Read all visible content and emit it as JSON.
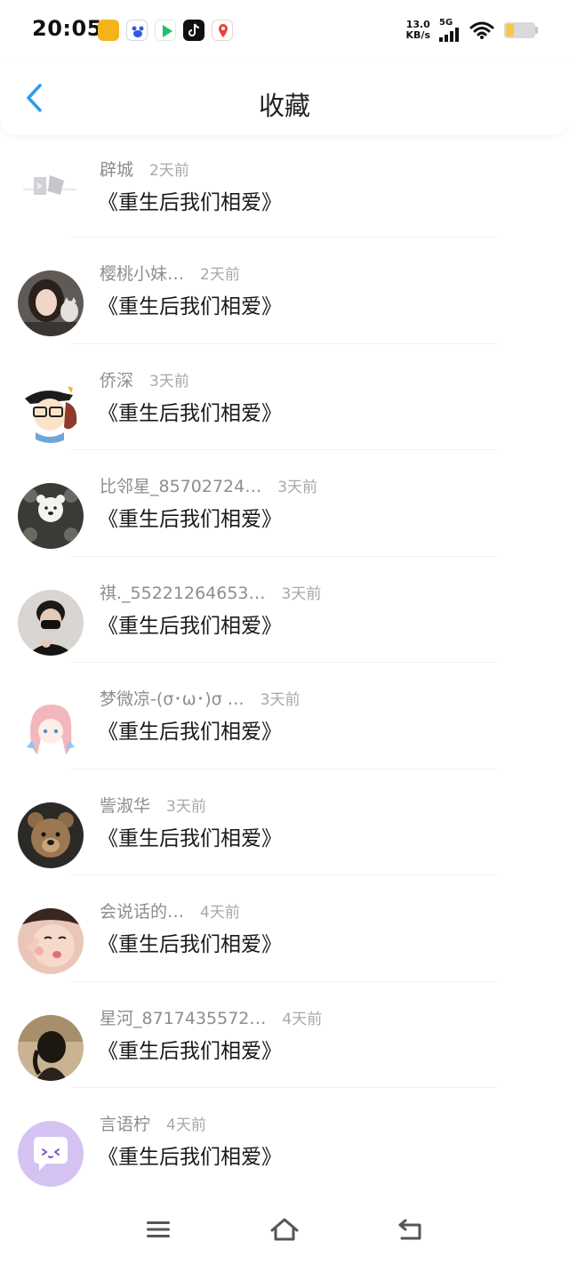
{
  "status_bar": {
    "time": "20:05",
    "net_speed_value": "13.0",
    "net_speed_unit": "KB/s",
    "network": "5G",
    "battery_color": "#f2c94c"
  },
  "header": {
    "title": "收藏",
    "back_icon": "chevron-left-icon",
    "accent_color": "#2f9bea"
  },
  "favorites": [
    {
      "user": "辟城",
      "time": "2天前",
      "title": "《重生后我们相爱》",
      "avatar": "placeholder-logo"
    },
    {
      "user": "樱桃小妹…",
      "time": "2天前",
      "title": "《重生后我们相爱》",
      "avatar": "girl-with-cat"
    },
    {
      "user": "侨深",
      "time": "3天前",
      "title": "《重生后我们相爱》",
      "avatar": "cartoon-boy"
    },
    {
      "user": "比邻星_85702724…",
      "time": "3天前",
      "title": "《重生后我们相爱》",
      "avatar": "bear-pattern"
    },
    {
      "user": "祺._55221264653…",
      "time": "3天前",
      "title": "《重生后我们相爱》",
      "avatar": "masked-boy"
    },
    {
      "user": "梦微凉-(σ･ω･)σ …",
      "time": "3天前",
      "title": "《重生后我们相爱》",
      "avatar": "anime-girl"
    },
    {
      "user": "訾淑华",
      "time": "3天前",
      "title": "《重生后我们相爱》",
      "avatar": "teddy-bear"
    },
    {
      "user": "会说话的…",
      "time": "4天前",
      "title": "《重生后我们相爱》",
      "avatar": "baby-face"
    },
    {
      "user": "星河_8717435572…",
      "time": "4天前",
      "title": "《重生后我们相爱》",
      "avatar": "girl-back"
    },
    {
      "user": "言语柠",
      "time": "4天前",
      "title": "《重生后我们相爱》",
      "avatar": "purple-chat-bubble"
    }
  ],
  "nav_bar": {
    "menu_icon": "menu-icon",
    "home_icon": "home-icon",
    "back_icon": "back-icon"
  }
}
